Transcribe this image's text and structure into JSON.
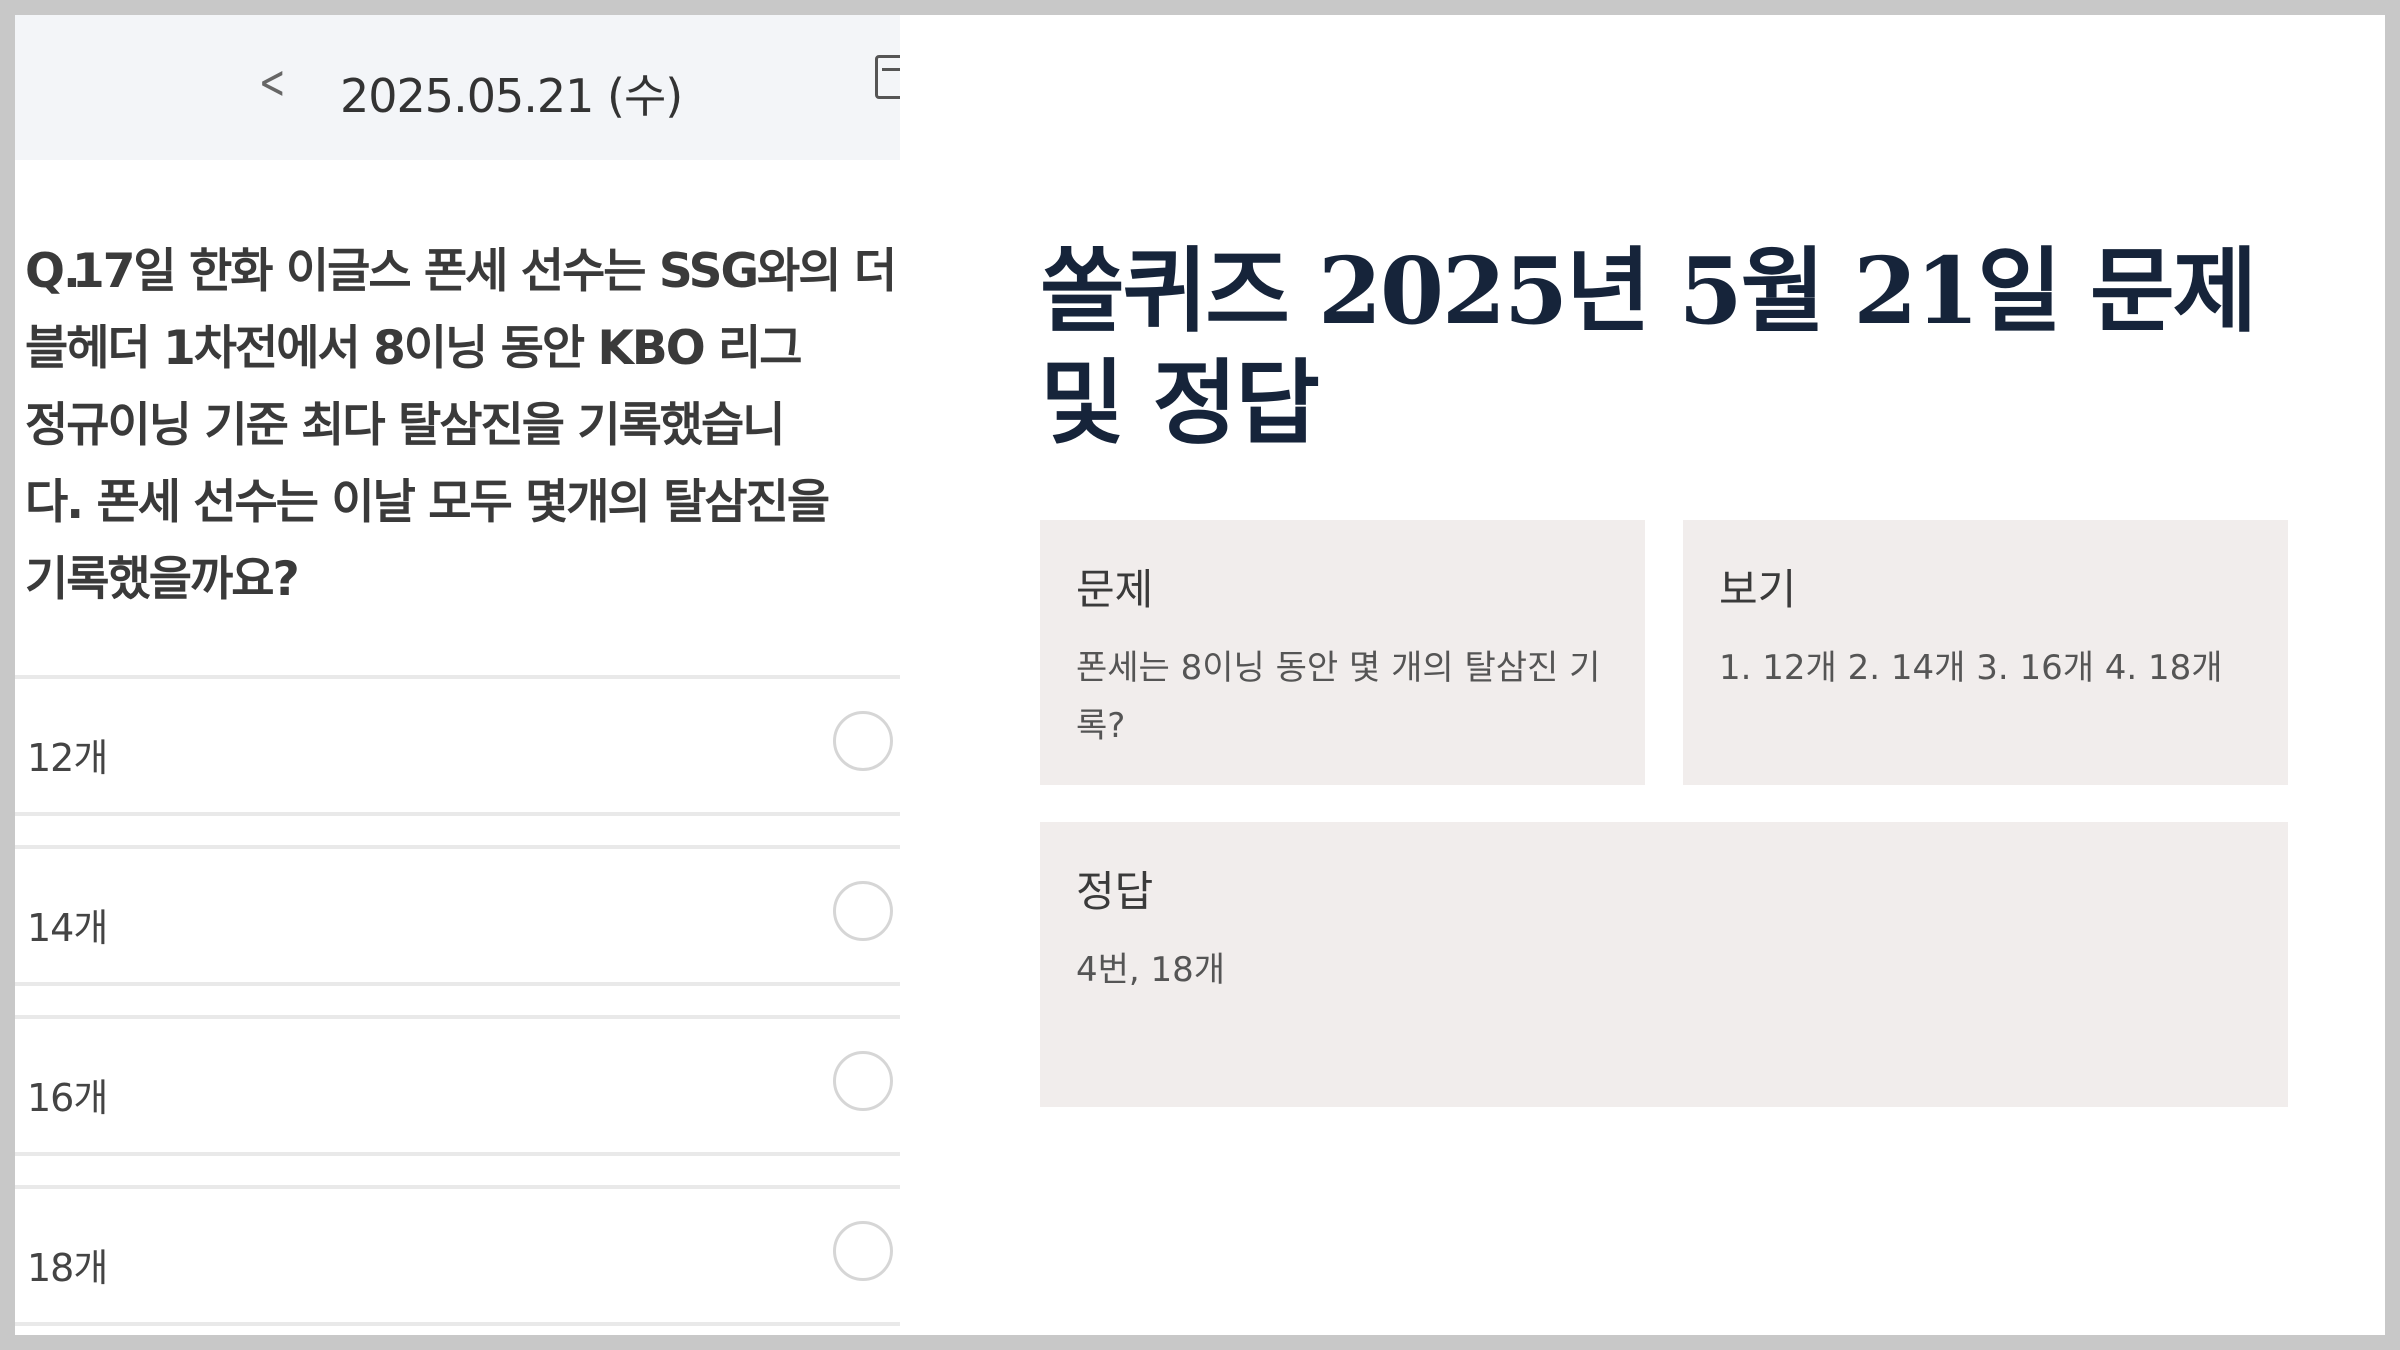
{
  "quiz_screenshot": {
    "date": "2025.05.21 (수)",
    "question_prefix": "Q.",
    "question_text": "17일 한화 이글스 폰세 선수는 SSG와의 더\n블헤더 1차전에서 8이닝 동안 KBO 리그\n정규이닝 기준 최다 탈삼진을 기록했습니\n다. 폰세 선수는 이날 모두 몇개의 탈삼진을\n기록했을까요?",
    "options": [
      "12개",
      "14개",
      "16개",
      "18개"
    ],
    "icons": {
      "back": "chevron-left-icon",
      "calendar": "calendar-icon",
      "radio": "radio-button-icon"
    }
  },
  "article": {
    "title": "쏠퀴즈 2025년 5월 21일 문제 및 정답",
    "problem": {
      "heading": "문제",
      "body": "폰세는 8이닝 동안 몇 개의 탈삼진 기록?"
    },
    "choices": {
      "heading": "보기",
      "body": "1. 12개 2. 14개 3. 16개 4. 18개"
    },
    "answer": {
      "heading": "정답",
      "body": "4번, 18개"
    }
  },
  "colors": {
    "title": "#16243a",
    "card_bg": "#f1edec",
    "header_bg": "#f3f5f8",
    "outer_bg": "#c8c8c8"
  }
}
